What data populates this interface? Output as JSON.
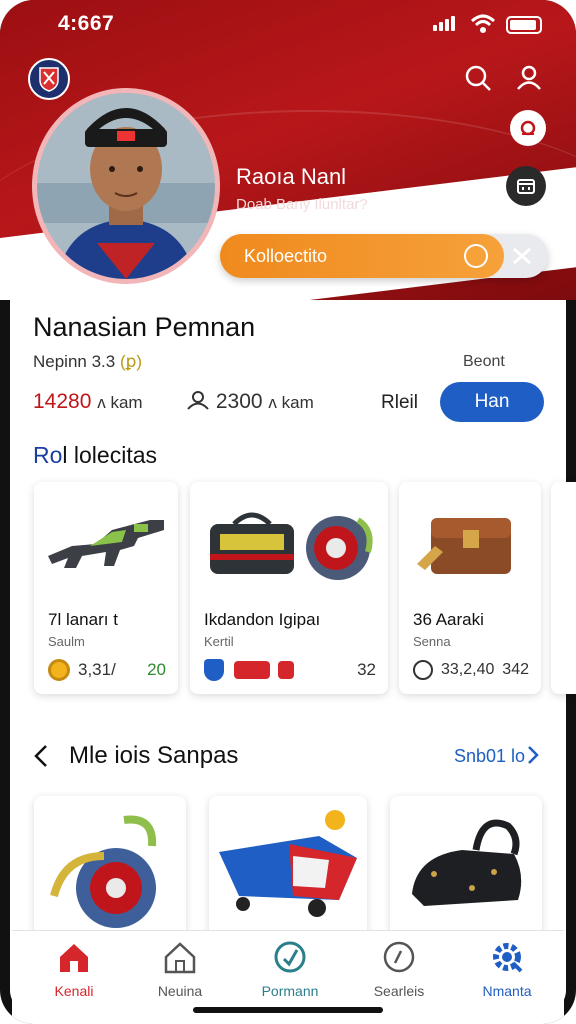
{
  "status_bar": {
    "time": "4:667"
  },
  "profile": {
    "name": "Raoıa Nanl",
    "subtitle": "Doab Bany Ilunltar?",
    "collect_label": "Kolloectito"
  },
  "section": {
    "title": "Nanasian Pemnan",
    "sub_left_prefix": "Nepinn 3.3 ",
    "sub_left_highlight": "(ꝑ)",
    "sub_right": "Beont",
    "stat1_value": "14280",
    "stat1_unit": "ʌ kam",
    "stat2_value": "2300",
    "stat2_unit": "ʌ kam",
    "rel_label": "Rleil",
    "button_label": "Han"
  },
  "collection": {
    "title_prefix": "Ro",
    "title_rest": "l lolecitas",
    "cards": [
      {
        "name": "7Ɩ lanarı t",
        "type": "Saulm",
        "price": "3,31/",
        "count": "20"
      },
      {
        "name": "Ikdandon Igipaı",
        "type": "Kertil",
        "price": "",
        "count": "32"
      },
      {
        "name": "36 Aaraki",
        "type": "Senna",
        "price": "33,2,40",
        "count": "342"
      }
    ]
  },
  "more": {
    "title": "Mle iois Sanpas",
    "link": "Snb01 lo"
  },
  "bottom_nav": [
    {
      "label": "Kenali",
      "icon": "home-icon",
      "color": "#d4262b"
    },
    {
      "label": "Neuina",
      "icon": "house-outline-icon",
      "color": "#555555"
    },
    {
      "label": "Pormann",
      "icon": "badge-icon",
      "color": "#2b7f8a"
    },
    {
      "label": "Searleis",
      "icon": "search-circle-icon",
      "color": "#555555"
    },
    {
      "label": "Nmanta",
      "icon": "settings-icon",
      "color": "#1f5ec4"
    }
  ],
  "colors": {
    "primary_red": "#b8171a",
    "accent_orange": "#f39a2e",
    "accent_blue": "#1f5ec4"
  }
}
